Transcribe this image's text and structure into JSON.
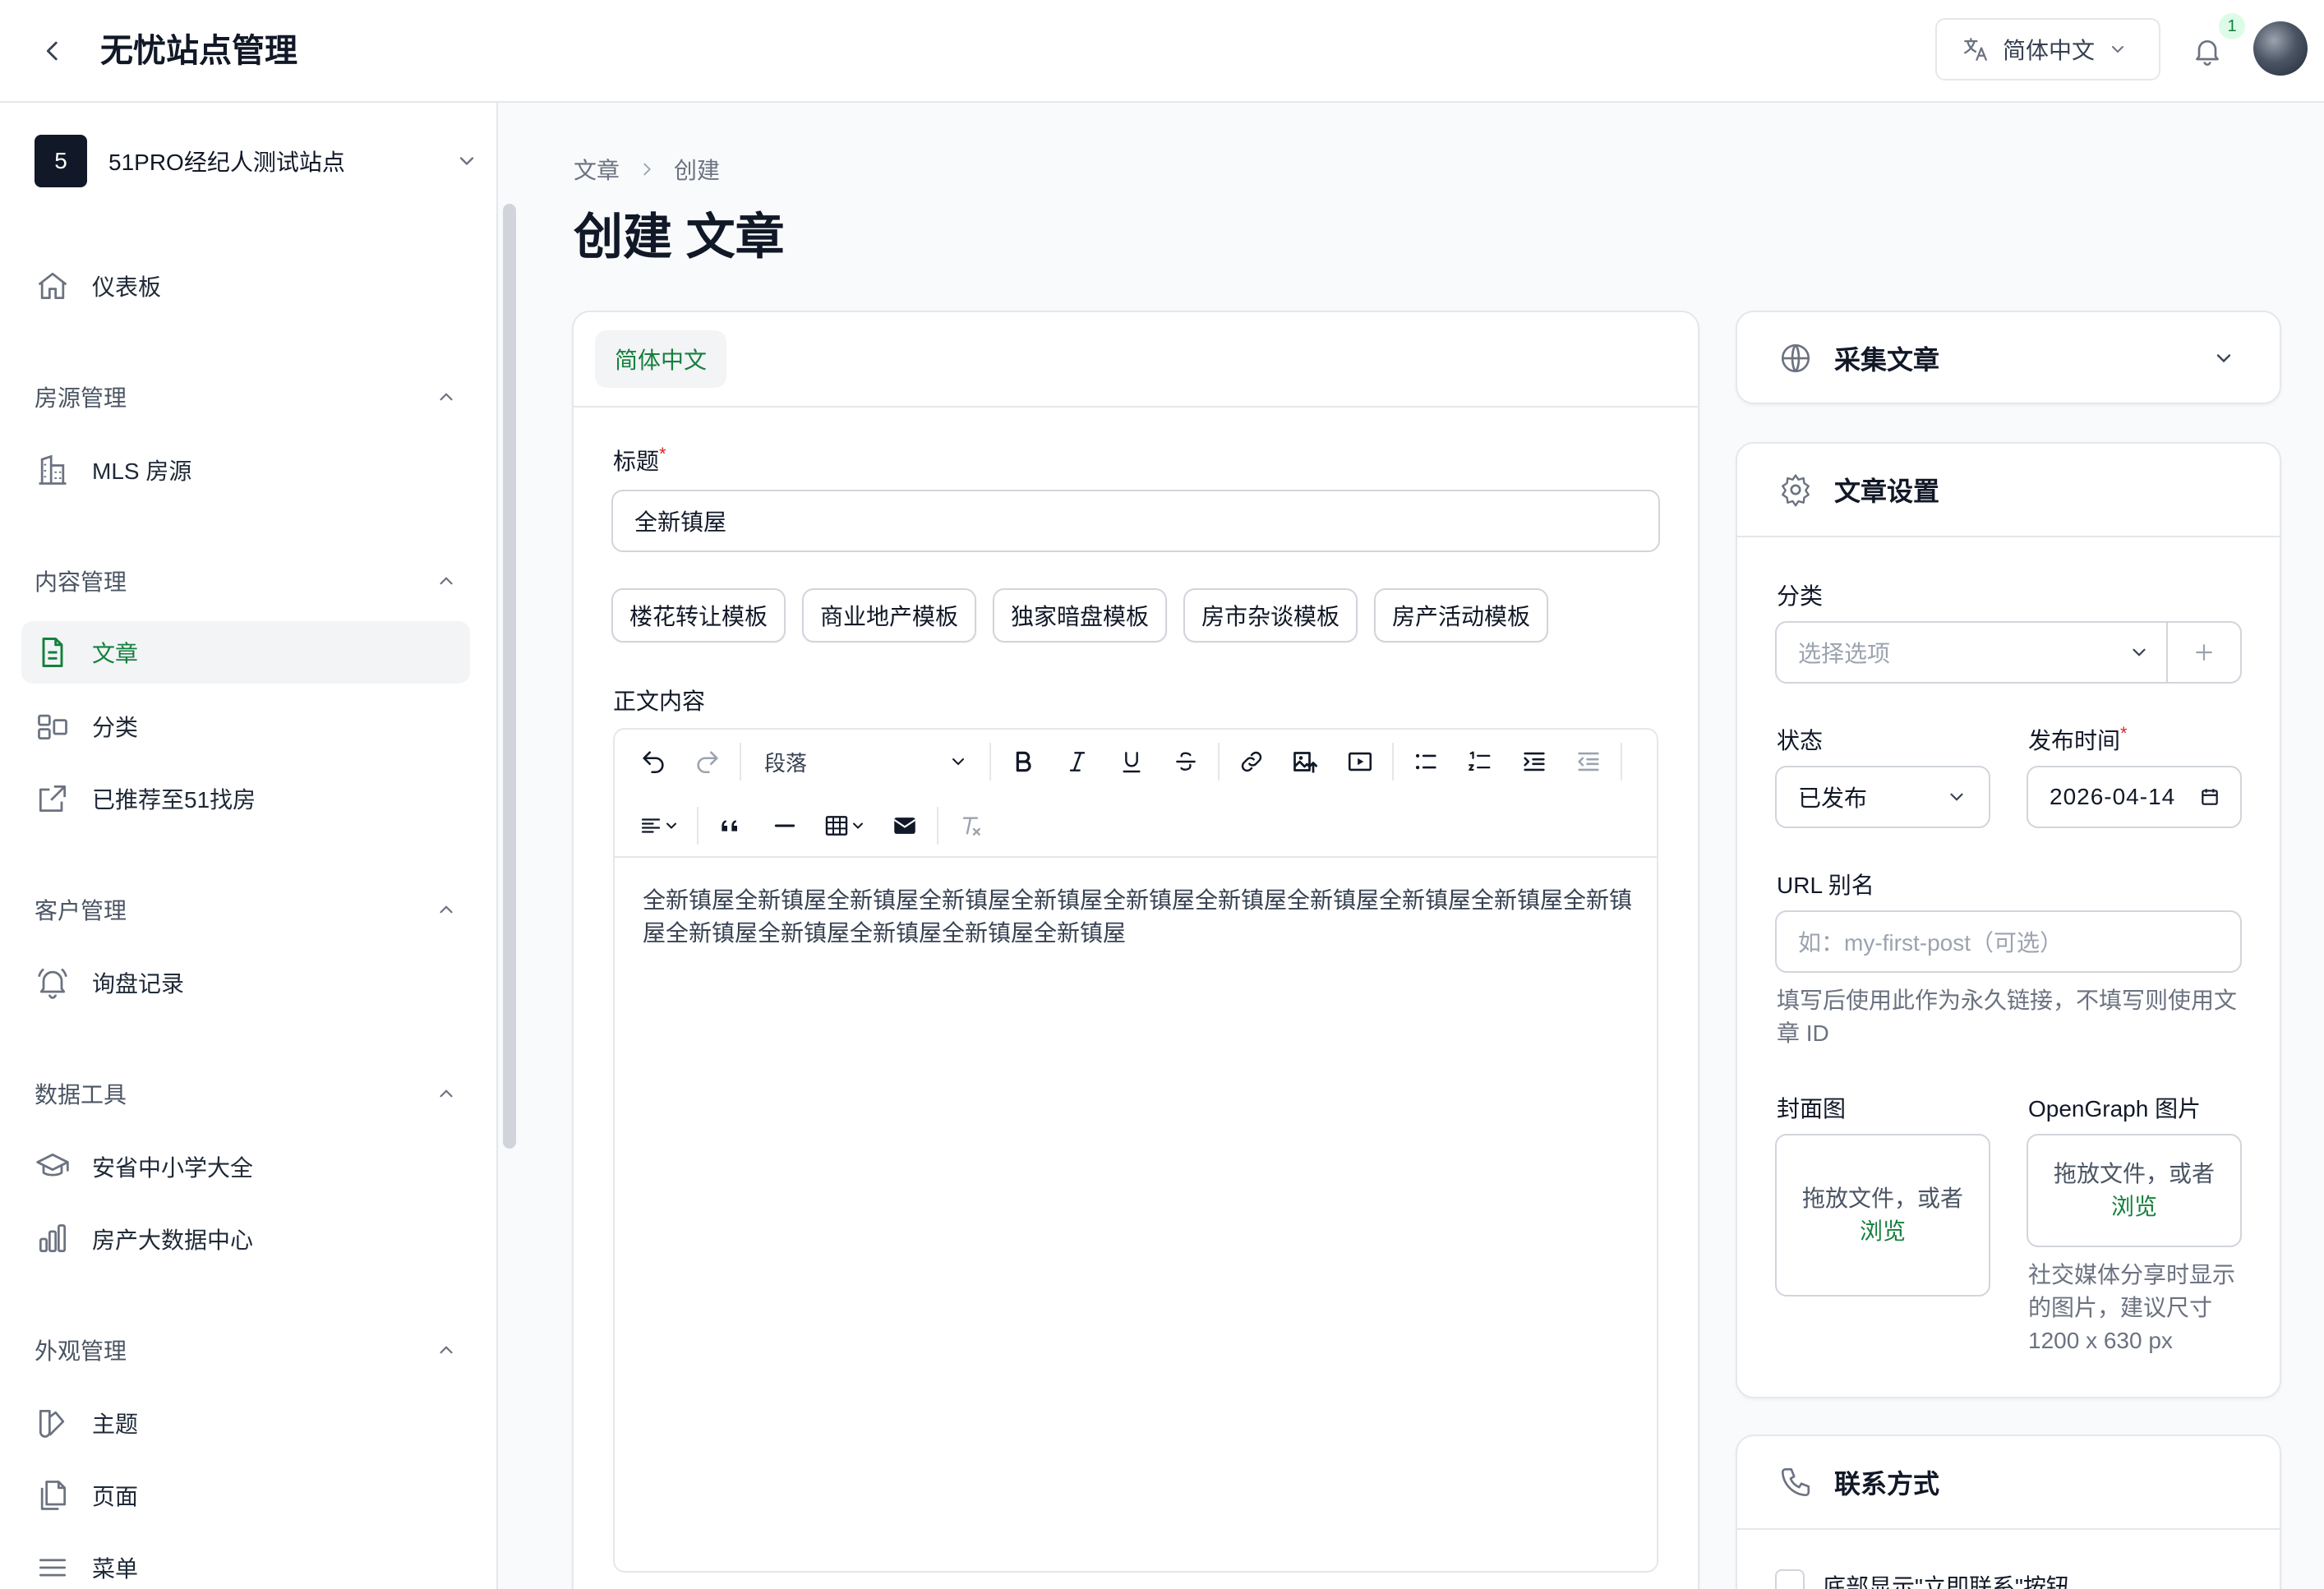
{
  "app": {
    "title": "无忧站点管理"
  },
  "header": {
    "language": "简体中文",
    "notification_count": "1"
  },
  "sidebar": {
    "site_badge": "5",
    "site_name": "51PRO经纪人测试站点",
    "dashboard": "仪表板",
    "groups": {
      "listings": "房源管理",
      "content": "内容管理",
      "customers": "客户管理",
      "data_tools": "数据工具",
      "appearance": "外观管理"
    },
    "items": {
      "mls": "MLS 房源",
      "articles": "文章",
      "categories": "分类",
      "recommended": "已推荐至51找房",
      "inquiries": "询盘记录",
      "schools": "安省中小学大全",
      "bigdata": "房产大数据中心",
      "themes": "主题",
      "pages": "页面",
      "menus": "菜单"
    }
  },
  "breadcrumb": {
    "parent": "文章",
    "current": "创建"
  },
  "page": {
    "title": "创建 文章"
  },
  "editor_card": {
    "lang_tab": "简体中文",
    "title_label": "标题",
    "required_mark": "*",
    "title_value": "全新镇屋",
    "templates": [
      "楼花转让模板",
      "商业地产模板",
      "独家暗盘模板",
      "房市杂谈模板",
      "房产活动模板"
    ],
    "content_label": "正文内容",
    "block_format": "段落",
    "content": "全新镇屋全新镇屋全新镇屋全新镇屋全新镇屋全新镇屋全新镇屋全新镇屋全新镇屋全新镇屋全新镇屋全新镇屋全新镇屋全新镇屋全新镇屋全新镇屋"
  },
  "collect_card": {
    "title": "采集文章"
  },
  "settings_card": {
    "title": "文章设置",
    "category_label": "分类",
    "category_placeholder": "选择选项",
    "status_label": "状态",
    "status_value": "已发布",
    "publish_label": "发布时间",
    "required_mark": "*",
    "publish_value": "2026-04-14",
    "slug_label": "URL 别名",
    "slug_placeholder": "如：my-first-post（可选）",
    "slug_help": "填写后使用此作为永久链接，不填写则使用文章 ID",
    "cover_label": "封面图",
    "og_label": "OpenGraph 图片",
    "upload_text": "拖放文件，或者",
    "upload_link": "浏览",
    "og_help": "社交媒体分享时显示的图片，建议尺寸 1200 x 630 px"
  },
  "contact_card": {
    "title": "联系方式",
    "checkbox_label": "底部显示\"立即联系\"按钮"
  },
  "colors": {
    "accent": "#15803d",
    "badge_bg": "#dcfce7"
  }
}
